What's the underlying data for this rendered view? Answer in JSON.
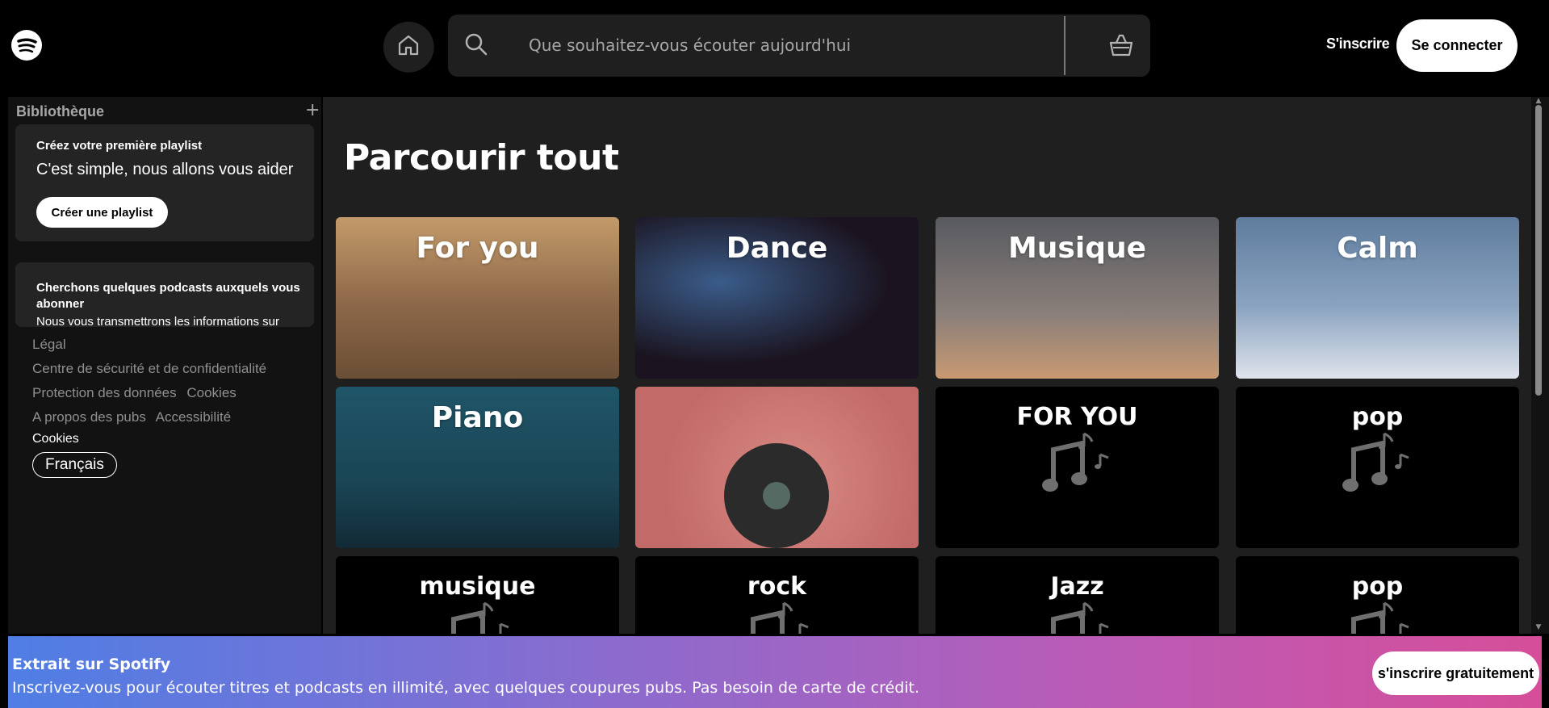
{
  "topbar": {
    "search_placeholder": "Que souhaitez-vous écouter aujourd'hui",
    "signup_label": "S'inscrire",
    "login_label": "Se connecter"
  },
  "sidebar": {
    "title": "Bibliothèque",
    "plus": "+",
    "card1": {
      "title": "Créez votre première playlist",
      "subtitle": "C'est simple, nous allons vous aider",
      "button": "Créer une playlist"
    },
    "card2": {
      "title": "Cherchons quelques podcasts auxquels vous abonner",
      "subtitle": "Nous vous transmettrons les informations sur"
    },
    "legal": {
      "l1": "Légal",
      "l2": "Centre de sécurité et de confidentialité",
      "l3a": "Protection des données",
      "l3b": "Cookies",
      "l4a": "A propos des pubs",
      "l4b": "Accessibilité"
    },
    "cookies": "Cookies",
    "language": "Français"
  },
  "main": {
    "heading": "Parcourir tout",
    "tiles": [
      {
        "label": "For you",
        "bg": "#8a6a4a"
      },
      {
        "label": "Dance",
        "bg": "#1b1420"
      },
      {
        "label": "Musique",
        "bg": "#6c6e74"
      },
      {
        "label": "Calm",
        "bg": "#6d87a8"
      },
      {
        "label": "Piano",
        "bg": "#1c4a5c"
      },
      {
        "label": "",
        "bg": "#c26a68"
      },
      {
        "label": "FOR YOU",
        "bg": "#000000"
      },
      {
        "label": "pop",
        "bg": "#000000"
      },
      {
        "label": "musique",
        "bg": "#000000"
      },
      {
        "label": "rock",
        "bg": "#000000"
      },
      {
        "label": "Jazz",
        "bg": "#000000"
      },
      {
        "label": "pop",
        "bg": "#000000"
      }
    ]
  },
  "banner": {
    "title": "Extrait sur Spotify",
    "subtitle": "Inscrivez-vous pour écouter titres et podcasts en illimité, avec quelques coupures pubs. Pas besoin de carte de crédit.",
    "button": "s'inscrire gratuitement"
  },
  "icons": {
    "logo": "spotify-logo-icon",
    "home": "home-icon",
    "search": "search-icon",
    "browse": "browse-basket-icon",
    "note": "music-note-icon"
  }
}
